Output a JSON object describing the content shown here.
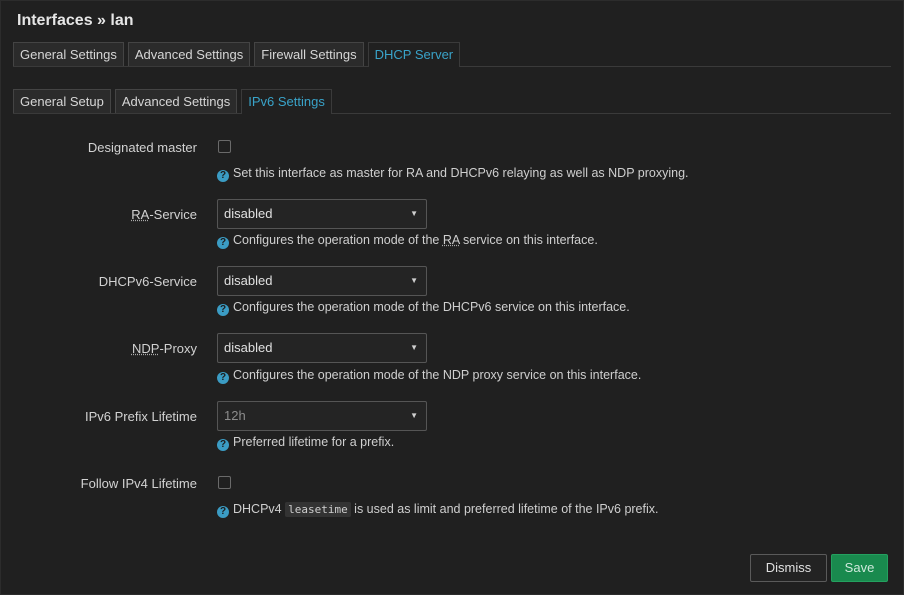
{
  "dialog": {
    "title": "Interfaces » lan"
  },
  "top_tabs": [
    {
      "label": "General Settings",
      "active": false
    },
    {
      "label": "Advanced Settings",
      "active": false
    },
    {
      "label": "Firewall Settings",
      "active": false
    },
    {
      "label": "DHCP Server",
      "active": true
    }
  ],
  "sub_tabs": [
    {
      "label": "General Setup",
      "active": false
    },
    {
      "label": "Advanced Settings",
      "active": false
    },
    {
      "label": "IPv6 Settings",
      "active": true
    }
  ],
  "fields": {
    "designated_master": {
      "label": "Designated master",
      "checked": false,
      "help": "Set this interface as master for RA and DHCPv6 relaying as well as NDP proxying."
    },
    "ra_service": {
      "label_abbr": "RA",
      "label_rest": "-Service",
      "value": "disabled",
      "help_pre": "Configures the operation mode of the ",
      "help_abbr": "RA",
      "help_post": " service on this interface."
    },
    "dhcpv6_service": {
      "label": "DHCPv6-Service",
      "value": "disabled",
      "help": "Configures the operation mode of the DHCPv6 service on this interface."
    },
    "ndp_proxy": {
      "label_abbr": "NDP",
      "label_rest": "-Proxy",
      "value": "disabled",
      "help": "Configures the operation mode of the NDP proxy service on this interface."
    },
    "ipv6_prefix_lifetime": {
      "label": "IPv6 Prefix Lifetime",
      "value": "12h",
      "help": "Preferred lifetime for a prefix."
    },
    "follow_ipv4_lifetime": {
      "label": "Follow IPv4 Lifetime",
      "checked": false,
      "help_pre": "DHCPv4 ",
      "help_code": "leasetime",
      "help_post": " is used as limit and preferred lifetime of the IPv6 prefix."
    }
  },
  "icons": {
    "help": "question-circle-icon",
    "dropdown": "caret-down-icon"
  },
  "colors": {
    "accent": "#39a3c9",
    "save": "#198a4e",
    "background": "#202020"
  },
  "buttons": {
    "dismiss": "Dismiss",
    "save": "Save"
  }
}
